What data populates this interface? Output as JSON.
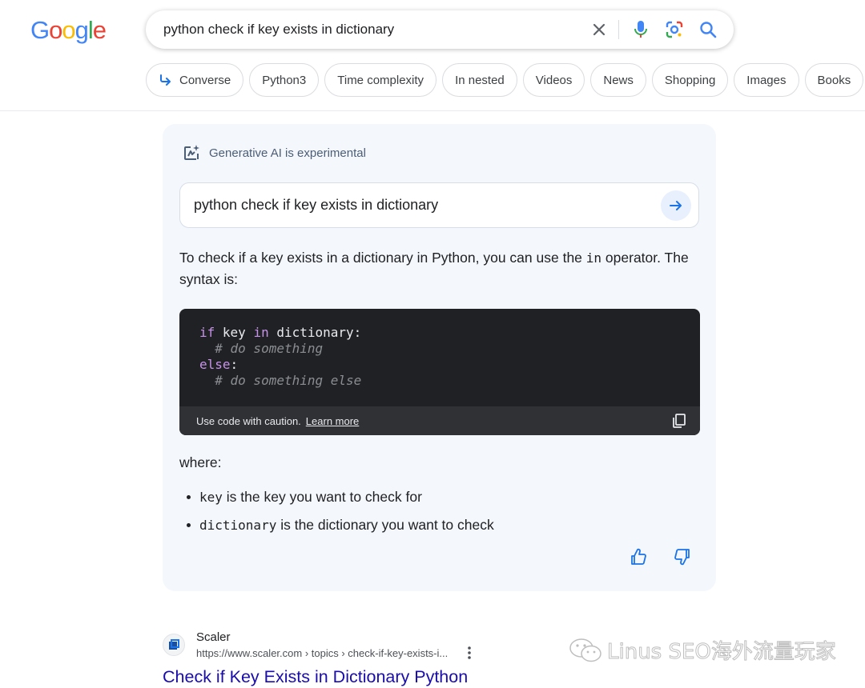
{
  "header": {
    "logo": {
      "letters": [
        {
          "ch": "G",
          "color": "#4285F4"
        },
        {
          "ch": "o",
          "color": "#EA4335"
        },
        {
          "ch": "o",
          "color": "#FBBC05"
        },
        {
          "ch": "g",
          "color": "#4285F4"
        },
        {
          "ch": "l",
          "color": "#34A853"
        },
        {
          "ch": "e",
          "color": "#EA4335"
        }
      ]
    },
    "search": {
      "query": "python check if key exists in dictionary",
      "icons": [
        "close-icon",
        "mic-icon",
        "lens-icon",
        "search-icon"
      ]
    }
  },
  "chips": [
    {
      "label": "Converse",
      "icon": "arrow-return-icon"
    },
    {
      "label": "Python3"
    },
    {
      "label": "Time complexity"
    },
    {
      "label": "In nested"
    },
    {
      "label": "Videos"
    },
    {
      "label": "News"
    },
    {
      "label": "Shopping"
    },
    {
      "label": "Images"
    },
    {
      "label": "Books"
    }
  ],
  "sge": {
    "badge": "Generative AI is experimental",
    "query": "python check if key exists in dictionary",
    "answer_prefix": "To check if a key exists in a dictionary in Python, you can use the",
    "answer_code": "in",
    "answer_suffix": "operator. The syntax is:",
    "code_lines": [
      {
        "parts": [
          {
            "t": "if",
            "c": "kw"
          },
          {
            "t": " key "
          },
          {
            "t": "in",
            "c": "kw"
          },
          {
            "t": " dictionary:"
          }
        ]
      },
      {
        "parts": [
          {
            "t": "  # do something",
            "c": "cm"
          }
        ]
      },
      {
        "parts": [
          {
            "t": "else",
            "c": "kw"
          },
          {
            "t": ":"
          }
        ]
      },
      {
        "parts": [
          {
            "t": "  # do something else",
            "c": "cm"
          }
        ]
      }
    ],
    "code_caution": "Use code with caution.",
    "code_learn_more": "Learn more",
    "where_label": "where:",
    "bullets": [
      {
        "code": "key",
        "text": "is the key you want to check for"
      },
      {
        "code": "dictionary",
        "text": "is the dictionary you want to check"
      }
    ],
    "colors": {
      "accent": "#1a73e8",
      "panel_bg": "#f4f7fc"
    }
  },
  "result": {
    "site": "Scaler",
    "url": "https://www.scaler.com › topics › check-if-key-exists-i...",
    "title": "Check if Key Exists in Dictionary Python"
  },
  "watermark": {
    "text": "Linus SEO海外流量玩家"
  }
}
